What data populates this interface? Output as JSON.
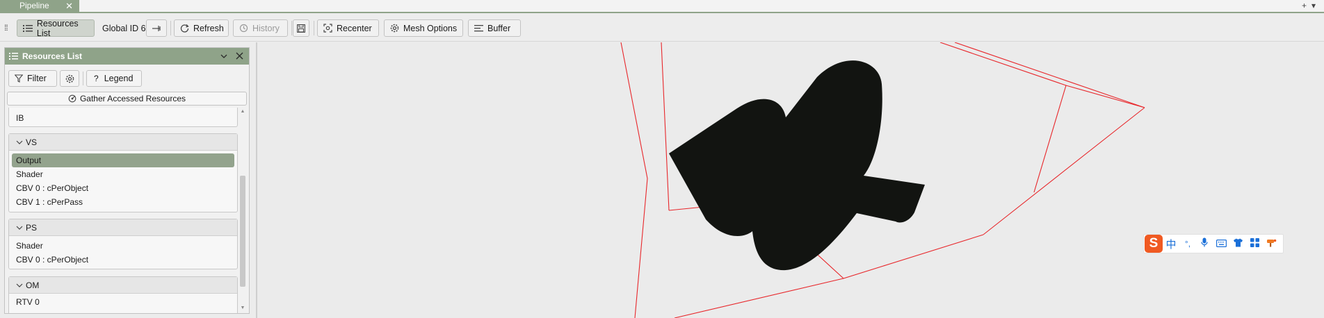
{
  "tab": {
    "title": "Pipeline",
    "close": "✕",
    "add": "+",
    "menu": "▾"
  },
  "toolbar": {
    "resources_list": "Resources List",
    "global_id": "Global ID 6",
    "refresh": "Refresh",
    "history": "History",
    "recenter": "Recenter",
    "mesh_options": "Mesh Options",
    "buffer": "Buffer"
  },
  "panel": {
    "title": "Resources List",
    "filter": "Filter",
    "legend": "Legend",
    "gather": "Gather Accessed Resources",
    "ib_item": "IB",
    "groups": [
      {
        "name": "VS",
        "items": [
          "Output",
          "Shader",
          "CBV 0 : cPerObject",
          "CBV 1 : cPerPass"
        ]
      },
      {
        "name": "PS",
        "items": [
          "Shader",
          "CBV 0 : cPerObject"
        ]
      },
      {
        "name": "OM",
        "items": [
          "RTV 0"
        ]
      }
    ],
    "selected": "Output"
  },
  "ime": {
    "logo": "S",
    "icons": [
      "中",
      "°,",
      "mic-icon",
      "keyboard-icon",
      "shirt-icon",
      "apps-icon",
      "hammer-icon"
    ]
  },
  "colors": {
    "accent": "#8fa389",
    "wireframe": "#e8262a",
    "mesh": "#121411"
  }
}
